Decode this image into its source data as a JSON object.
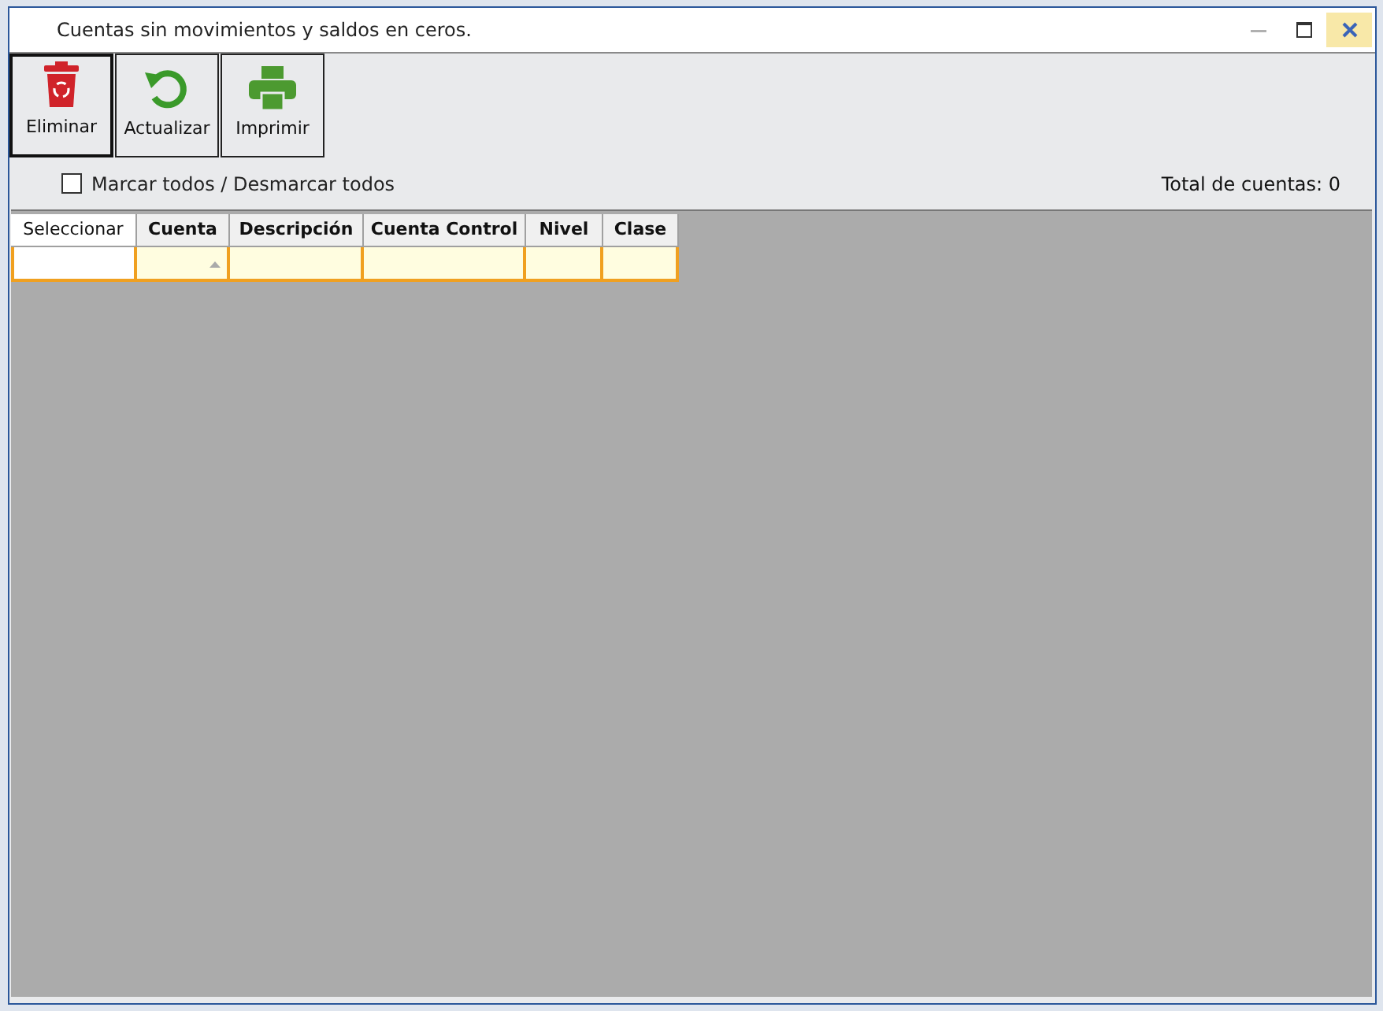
{
  "window": {
    "title": "Cuentas sin movimientos y saldos en ceros.",
    "minimize_disabled": true
  },
  "toolbar": [
    {
      "label": "Eliminar",
      "kind": "delete",
      "focused": true
    },
    {
      "label": "Actualizar",
      "kind": "refresh",
      "focused": false
    },
    {
      "label": "Imprimir",
      "kind": "print",
      "focused": false
    }
  ],
  "select_all": {
    "label": "Marcar todos / Desmarcar todos",
    "checked": false
  },
  "total": "Total de cuentas: 0",
  "table": {
    "columns": [
      "Seleccionar",
      "Cuenta",
      "Descripción",
      "Cuenta Control",
      "Nivel",
      "Clase"
    ]
  }
}
